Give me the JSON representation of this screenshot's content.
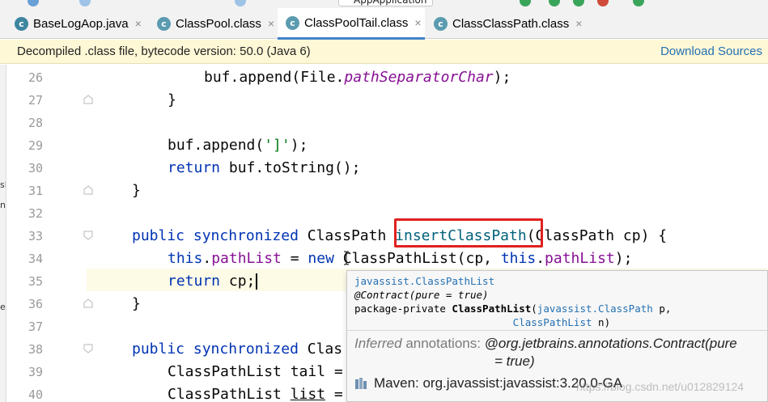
{
  "toolbar": {
    "run_config_label": "AppApplication"
  },
  "tabs": [
    {
      "label": "BaseLogAop.java",
      "icon": "class-icon",
      "close": "×",
      "active": false
    },
    {
      "label": "ClassPool.class",
      "icon": "class-icon",
      "close": "×",
      "active": false
    },
    {
      "label": "ClassPoolTail.class",
      "icon": "class-icon",
      "close": "×",
      "active": true
    },
    {
      "label": "ClassClassPath.class",
      "icon": "class-icon",
      "close": "×",
      "active": false
    }
  ],
  "notice": {
    "message": "Decompiled .class file, bytecode version: 50.0 (Java 6)",
    "action": "Download Sources"
  },
  "left_edge": [
    "sl",
    "n",
    "er"
  ],
  "line_numbers": [
    "26",
    "27",
    "28",
    "29",
    "30",
    "31",
    "32",
    "33",
    "34",
    "35",
    "36",
    "37",
    "38",
    "39",
    "40"
  ],
  "code": {
    "l26": {
      "a": "buf.append(File.",
      "b": "pathSeparatorChar",
      "c": ");"
    },
    "l27": "}",
    "l29": {
      "a": "buf.append(",
      "b": "']'",
      "c": ");"
    },
    "l30": {
      "kw": "return",
      "rest": " buf.toString();"
    },
    "l31": "}",
    "l33": {
      "kw1": "public",
      "kw2": "synchronized",
      "type": " ClassPath ",
      "method": "insertClassPath",
      "rest": "(ClassPath cp) {"
    },
    "l34": {
      "kw1": "this",
      "dot": ".",
      "f1": "pathList",
      "eq": " = ",
      "kw2": "new",
      "mid": " ClassPathList(cp, ",
      "kw3": "this",
      "dot2": ".",
      "f2": "pathList",
      "end": ");"
    },
    "l35": {
      "kw": "return",
      "rest": " cp;"
    },
    "l36": "}",
    "l38": {
      "kw1": "public",
      "kw2": "synchronized",
      "rest": " Clas"
    },
    "l39": "ClassPathList tail =",
    "l40": {
      "a": "ClassPathList ",
      "b": "list",
      "c": " ="
    }
  },
  "popup": {
    "class_link": "javassist.ClassPathList",
    "annotation": "@Contract(pure = true)",
    "sig_prefix": "package-private ",
    "sig_name": "ClassPathList",
    "sig_open": "(",
    "param1_type": "javassist.ClassPath",
    "param1_name": " p,",
    "param2_type": "ClassPathList",
    "param2_name": " n)",
    "inferred_label": "Inferred",
    "inferred_label2": " annotations: ",
    "inferred_value": "@org.jetbrains.annotations.Contract(pure",
    "inferred_value2": "= true)",
    "maven": "Maven: org.javassist:javassist:3.20.0-GA"
  },
  "watermark": "https://blog.csdn.net/u012829124",
  "colors": {
    "keyword": "#0033b3",
    "field": "#871094",
    "string": "#067d17",
    "method_decl": "#00627a",
    "highlight_box": "#e02020",
    "notice_bg": "#fff8d6",
    "link": "#2470b3"
  }
}
